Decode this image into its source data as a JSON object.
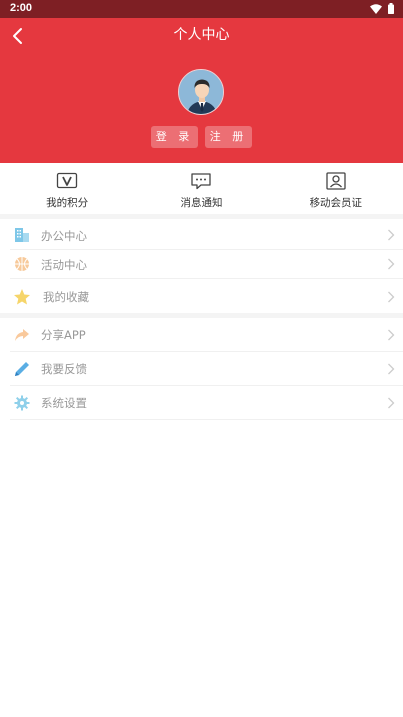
{
  "status_bar": {
    "time": "2:00",
    "icons": [
      "wifi-icon",
      "battery-icon"
    ]
  },
  "header": {
    "title": "个人中心",
    "back_icon": "chevron-left-icon",
    "avatar": "user-avatar",
    "login_label": "登 录",
    "register_label": "注 册",
    "bg_color": "#e5383f"
  },
  "quick_actions": [
    {
      "label": "我的积分",
      "icon": "points-v-icon"
    },
    {
      "label": "消息通知",
      "icon": "message-icon"
    },
    {
      "label": "移动会员证",
      "icon": "member-card-icon"
    }
  ],
  "menu_group_1": [
    {
      "label": "办公中心",
      "icon": "building-icon"
    },
    {
      "label": "活动中心",
      "icon": "basketball-icon"
    },
    {
      "label": "我的收藏",
      "icon": "star-icon"
    }
  ],
  "menu_group_2": [
    {
      "label": "分享APP",
      "icon": "share-arrow-icon"
    },
    {
      "label": "我要反馈",
      "icon": "pencil-icon"
    },
    {
      "label": "系统设置",
      "icon": "gear-icon"
    }
  ]
}
